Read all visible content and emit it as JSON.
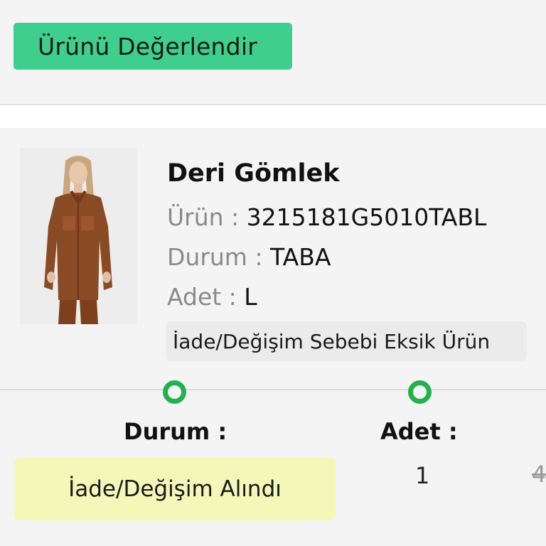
{
  "header": {
    "review_button_label": "Ürünü Değerlendir"
  },
  "product": {
    "image_icon": "product-photo-leather-shirt",
    "name": "Deri Gömlek",
    "code_label": "Ürün :",
    "code_value": "3215181G5010TABL",
    "color_label": "Durum :",
    "color_value": "TABA",
    "size_label": "Adet :",
    "size_value": "L",
    "reason_text": "İade/Değişim Sebebi Eksik Ürün"
  },
  "status": {
    "durum_label": "Durum :",
    "adet_label": "Adet :",
    "durum_value": "İade/Değişim Alındı",
    "adet_value": "1",
    "price_partial": "4"
  },
  "colors": {
    "accent_green": "#3ecf8e",
    "timeline_dot": "#22b14c",
    "status_bg": "#f3f7b8"
  }
}
